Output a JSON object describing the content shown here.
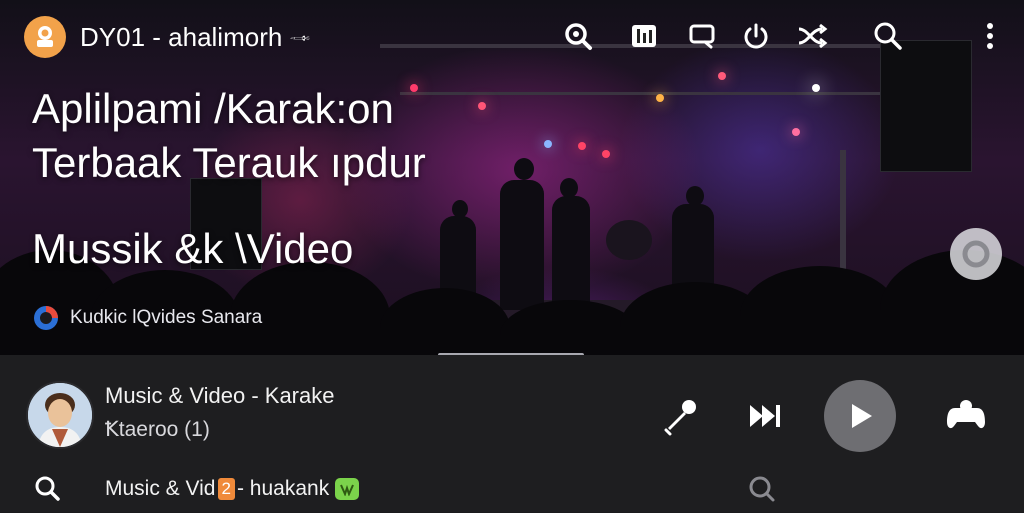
{
  "header": {
    "app_title": "DY01 - ahalimorh 🙬",
    "icons": [
      "search-zoom-icon",
      "mixer-icon",
      "cast-icon",
      "power-icon",
      "shuffle-icon",
      "search-icon",
      "more-vert-icon"
    ]
  },
  "hero": {
    "headline_line1": "Aplilpami /Karak:on",
    "headline_line2": "Terbaak Terauk ıpdur",
    "subheadline": "Mussik &k \\Video",
    "source_label": "Kudkic lQvides Sanara",
    "accent_blue": "#2b6fd6"
  },
  "player": {
    "track_title": "Music & Video - Karake",
    "track_subtitle": "Ꝁtaeroo  (1)",
    "play_button_color": "#6e6e72",
    "queue": {
      "text_before": "Music & Vid",
      "badge": "2",
      "text_after": " - huakank",
      "badge_color": "#f08a3a",
      "tag_color": "#7bd34b"
    }
  }
}
